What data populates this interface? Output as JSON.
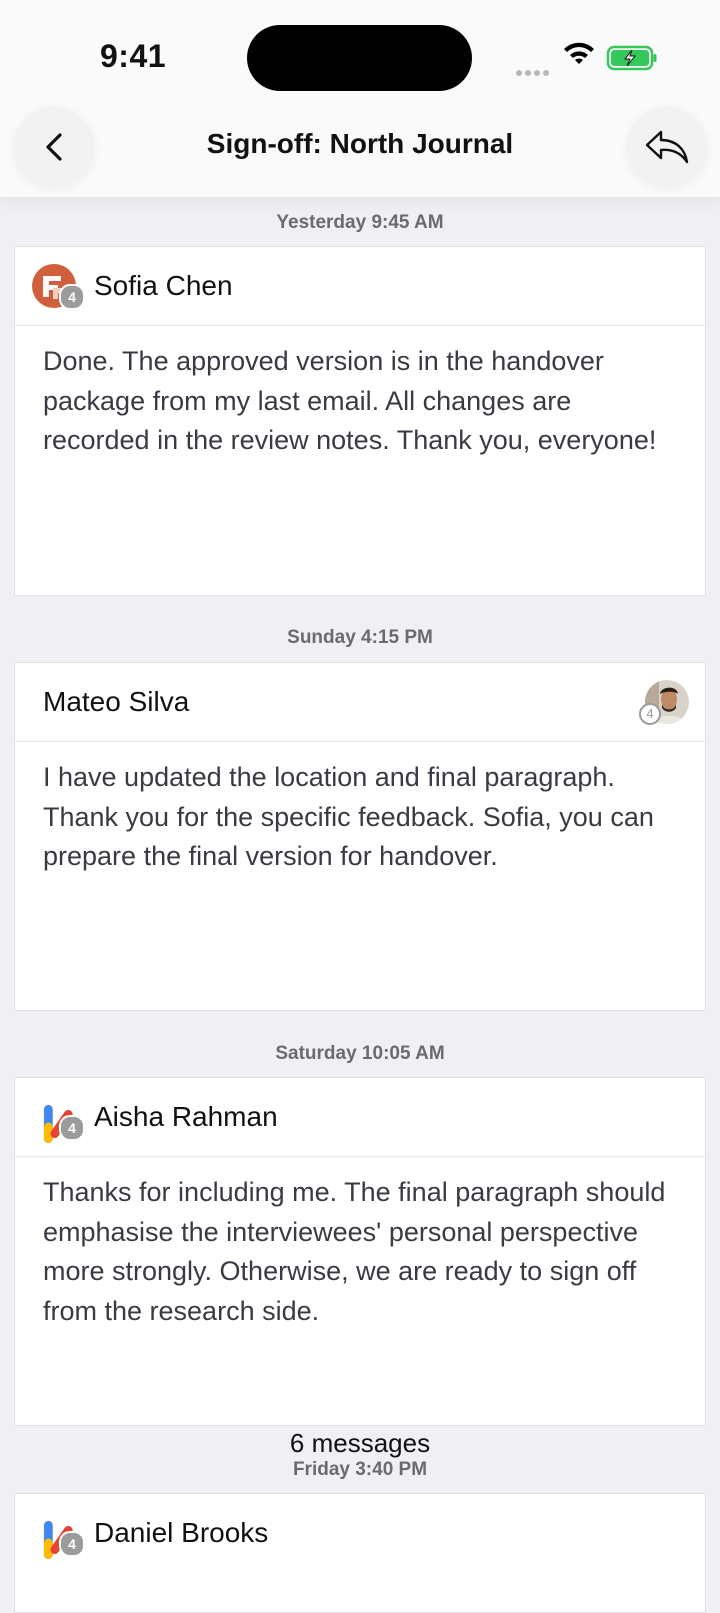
{
  "status_bar": {
    "time": "9:41"
  },
  "header": {
    "title": "Sign-off: North Journal"
  },
  "messages": [
    {
      "timestamp": "Yesterday 9:45 AM",
      "sender": "Sofia Chen",
      "badge": "4",
      "avatar": "brand-logo-orange",
      "body": "Done. The approved version is in the handover package from my last email. All changes are recorded in the review notes. Thank you, everyone!"
    },
    {
      "timestamp": "Sunday 4:15 PM",
      "sender": "Mateo Silva",
      "badge": "4",
      "avatar": "profile-photo",
      "body": "I have updated the location and final paragraph. Thank you for the specific feedback. Sofia, you can prepare the final version for handover."
    },
    {
      "timestamp": "Saturday 10:05 AM",
      "sender": "Aisha Rahman",
      "badge": "4",
      "avatar": "brand-logo-multicolor",
      "body": "Thanks for including me. The final paragraph should emphasise the interviewees' personal perspective more strongly. Otherwise, we are ready to sign off from the research side."
    },
    {
      "timestamp": "Friday 3:40 PM",
      "sender": "Daniel Brooks",
      "badge": "4",
      "avatar": "brand-logo-multicolor",
      "body": ""
    }
  ],
  "message_count": "6 messages",
  "colors": {
    "battery": "#34c759",
    "logo_orange": "#d0603d",
    "background": "#efeff4"
  },
  "icons": {
    "back": "chevron-left-icon",
    "reply": "reply-icon"
  }
}
